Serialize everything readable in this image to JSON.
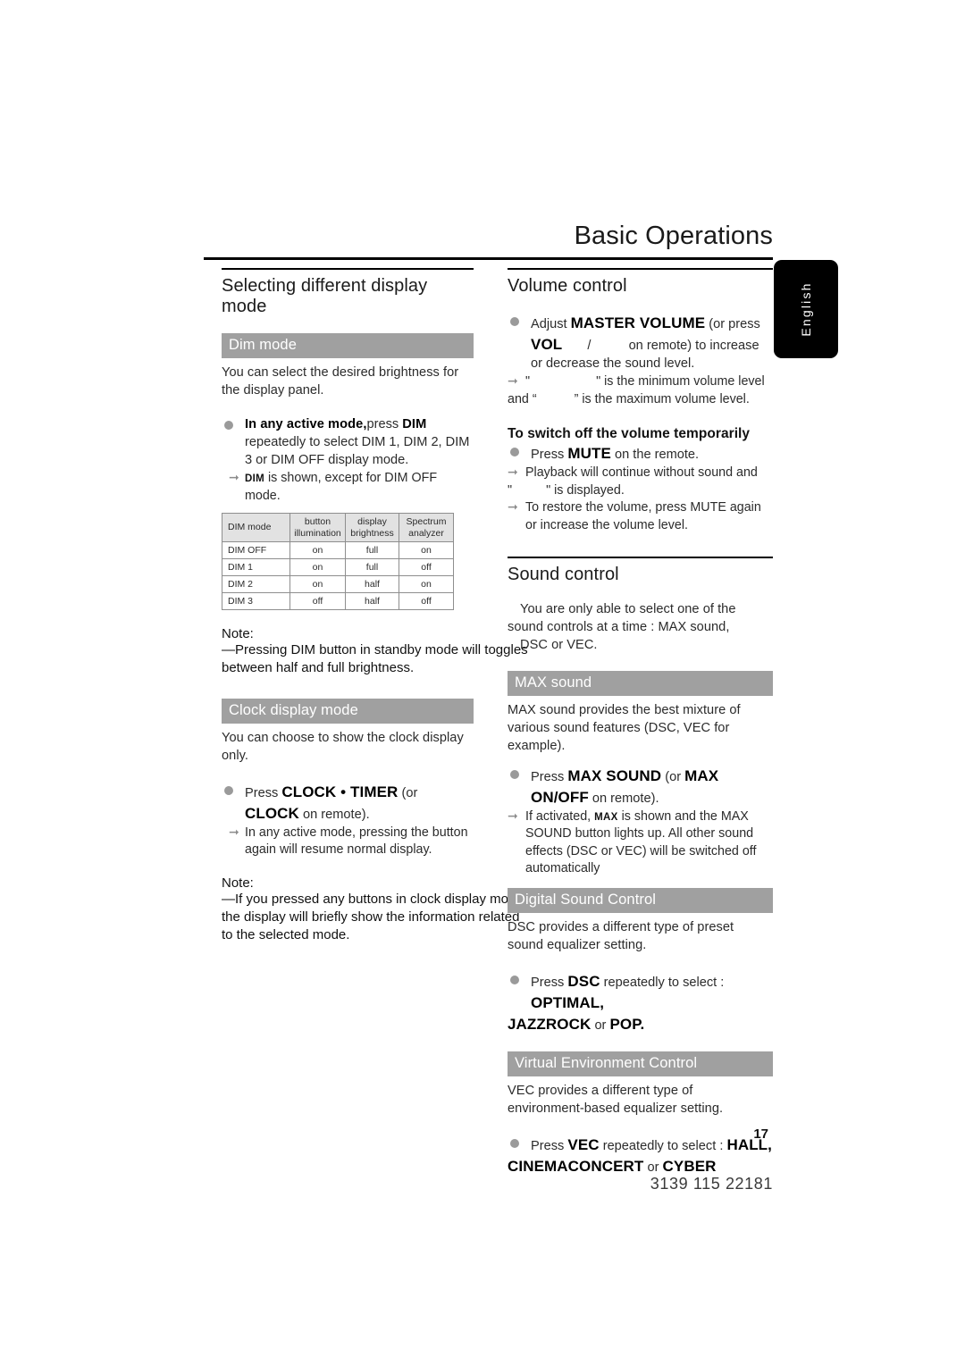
{
  "header": {
    "title": "Basic Operations",
    "language_tab": "English"
  },
  "left_column": {
    "section_title": "Selecting different display mode",
    "dim_mode": {
      "banner": "Dim mode",
      "intro": "You can select the desired brightness for the display panel.",
      "bullet_lead": "In any active mode,",
      "bullet_rest_1": "press",
      "bullet_key": "DIM",
      "bullet_rest_2": "repeatedly to select DIM 1, DIM 2, DIM 3 or DIM OFF display mode.",
      "arrow_pre": "",
      "arrow_key": "DIM",
      "arrow_text": "is shown, except for DIM OFF mode."
    },
    "dim_table": {
      "headers": [
        "DIM mode",
        "button illumination",
        "display brightness",
        "Spectrum analyzer"
      ],
      "header_lines": [
        [
          "DIM mode",
          ""
        ],
        [
          "button",
          "illumination"
        ],
        [
          "display",
          "brightness"
        ],
        [
          "Spectrum",
          "analyzer"
        ]
      ],
      "rows": [
        [
          "DIM OFF",
          "on",
          "full",
          "on"
        ],
        [
          "DIM 1",
          "on",
          "full",
          "off"
        ],
        [
          "DIM 2",
          "on",
          "half",
          "on"
        ],
        [
          "DIM 3",
          "off",
          "half",
          "off"
        ]
      ]
    },
    "note_1": {
      "label": "Note:",
      "line_1": "—Pressing DIM button in standby mode will toggles",
      "line_2": "between half and full brightness."
    },
    "clock_mode": {
      "banner": "Clock display mode",
      "intro": "You can choose to show the clock display only.",
      "bullet_pre": "Press",
      "bullet_key_1": "CLOCK • TIMER",
      "bullet_mid": "(or",
      "bullet_key_2": "CLOCK",
      "bullet_post": "on remote).",
      "arrow_text": "In any active mode, pressing the button again will resume normal display."
    },
    "note_2": {
      "label": "Note:",
      "line_1": "—If you pressed any buttons in clock display mode,",
      "line_2": "the display will briefly show the information related",
      "line_3": "to the selected mode."
    }
  },
  "right_column": {
    "volume": {
      "section_title": "Volume control",
      "bullet_pre": "Adjust",
      "bullet_key_1": "MASTER VOLUME",
      "bullet_mid_1": "(or press",
      "bullet_key_2": "VOL",
      "bullet_sep": "/",
      "bullet_mid_2": "on remote) to increase or decrease the sound level.",
      "arrow_1_pre": "\"",
      "arrow_1_post": "\" is the minimum volume level",
      "arrow_1_cont_pre": "and “",
      "arrow_1_cont_post": "” is the maximum volume level.",
      "sub_head": "To switch off the volume temporarily",
      "mute_pre": "Press",
      "mute_key": "MUTE",
      "mute_post": "on the remote.",
      "arrow_2_line1": "Playback will continue without sound and",
      "arrow_2_line2_pre": "\"",
      "arrow_2_line2_post": "\" is displayed.",
      "arrow_3": "To restore the volume, press MUTE again or increase the volume level."
    },
    "sound": {
      "section_title": "Sound control",
      "intro_line_1": "You are only able to select one of the",
      "intro_line_2": "sound controls at a time : MAX sound,",
      "intro_line_3": "DSC or VEC.",
      "max": {
        "banner": "MAX sound",
        "intro": "MAX sound provides the best mixture of various sound features (DSC, VEC for example).",
        "bullet_pre": "Press",
        "bullet_key_1": "MAX SOUND",
        "bullet_mid": "(or",
        "bullet_key_2": "MAX ON/OFF",
        "bullet_post": "on remote).",
        "arrow_pre": "If activated,",
        "arrow_key": "MAX",
        "arrow_post": "is shown and the MAX SOUND button lights up.  All other sound effects (DSC or VEC) will be switched off automatically"
      },
      "dsc": {
        "banner": "Digital Sound Control",
        "intro": "DSC provides a different type of preset sound equalizer setting.",
        "bullet_pre": "Press",
        "bullet_key": "DSC",
        "bullet_mid": "repeatedly to select :",
        "options_1": "OPTIMAL,",
        "options_2": "JAZZ",
        "options_3": "ROCK",
        "options_or": "or",
        "options_4": "POP."
      },
      "vec": {
        "banner": "Virtual Environment Control",
        "intro": "VEC provides a different type of environment-based equalizer setting.",
        "bullet_pre": "Press",
        "bullet_key": "VEC",
        "bullet_mid": "repeatedly to select :",
        "options_1": "HALL,",
        "options_2": "CINEMA",
        "options_3": "CONCERT",
        "options_or": "or",
        "options_4": "CYBER"
      }
    }
  },
  "footer": {
    "page_number": "17",
    "doc_code": "3139 115 22181"
  }
}
